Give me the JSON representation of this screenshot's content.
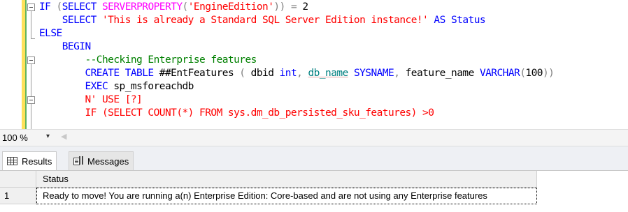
{
  "editor": {
    "lines": [
      [
        {
          "t": "IF ",
          "c": "kw"
        },
        {
          "t": "(",
          "c": "gr"
        },
        {
          "t": "SELECT ",
          "c": "kw"
        },
        {
          "t": "SERVERPROPERTY",
          "c": "fn"
        },
        {
          "t": "(",
          "c": "gr"
        },
        {
          "t": "'EngineEdition'",
          "c": "str"
        },
        {
          "t": ")) = ",
          "c": "gr"
        },
        {
          "t": "2",
          "c": "pl"
        }
      ],
      [
        {
          "t": "    SELECT ",
          "c": "kw"
        },
        {
          "t": "'This is already a Standard SQL Server Edition instance!'",
          "c": "str"
        },
        {
          "t": " AS ",
          "c": "kw"
        },
        {
          "t": "Status",
          "c": "kw"
        }
      ],
      [
        {
          "t": "ELSE",
          "c": "kw"
        }
      ],
      [
        {
          "t": "    BEGIN",
          "c": "kw"
        }
      ],
      [
        {
          "t": "        --Checking Enterprise features",
          "c": "cm"
        }
      ],
      [
        {
          "t": "        CREATE TABLE ",
          "c": "kw"
        },
        {
          "t": "##EntFeatures",
          "c": "pl"
        },
        {
          "t": " ( ",
          "c": "gr"
        },
        {
          "t": "dbid ",
          "c": "pl"
        },
        {
          "t": "int",
          "c": "kw"
        },
        {
          "t": ", ",
          "c": "gr"
        },
        {
          "t": "db_name",
          "c": "teal ul"
        },
        {
          "t": " SYSNAME",
          "c": "kw"
        },
        {
          "t": ", ",
          "c": "gr"
        },
        {
          "t": "feature_name ",
          "c": "pl"
        },
        {
          "t": "VARCHAR",
          "c": "kw"
        },
        {
          "t": "(",
          "c": "gr"
        },
        {
          "t": "100",
          "c": "pl"
        },
        {
          "t": "))",
          "c": "gr"
        }
      ],
      [
        {
          "t": "        EXEC ",
          "c": "kw"
        },
        {
          "t": "sp_msforeachdb",
          "c": "pl"
        }
      ],
      [
        {
          "t": "        N' USE [?]",
          "c": "str"
        }
      ],
      [
        {
          "t": "        IF (SELECT COUNT(*) FROM sys.dm_db_persisted_sku_features) >0",
          "c": "str"
        }
      ]
    ]
  },
  "zoom": {
    "value": "100 %"
  },
  "tabs": [
    {
      "label": "Results",
      "icon": "grid-icon"
    },
    {
      "label": "Messages",
      "icon": "messages-icon"
    }
  ],
  "results": {
    "columns": [
      "Status"
    ],
    "rows": [
      {
        "num": "1",
        "status": "Ready to move! You are running a(n) Enterprise Edition: Core-based and are not using any Enterprise features"
      }
    ]
  }
}
